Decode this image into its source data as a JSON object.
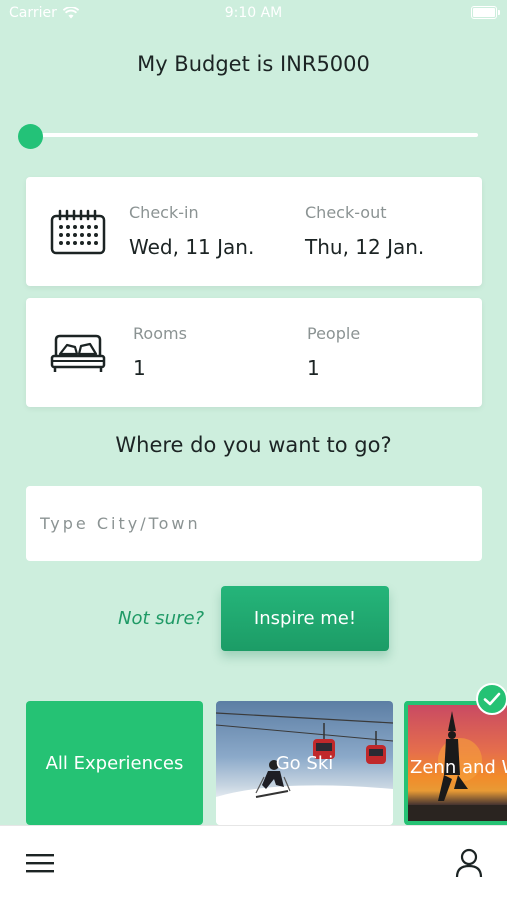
{
  "status_bar": {
    "carrier": "Carrier",
    "time": "9:10 AM"
  },
  "budget": {
    "title": "My Budget is INR5000",
    "slider_fraction": 0.0
  },
  "dates": {
    "checkin_label": "Check-in",
    "checkin_value": "Wed, 11 Jan.",
    "checkout_label": "Check-out",
    "checkout_value": "Thu, 12 Jan."
  },
  "occupancy": {
    "rooms_label": "Rooms",
    "rooms_value": "1",
    "people_label": "People",
    "people_value": "1"
  },
  "destination": {
    "question": "Where do you want to go?",
    "placeholder": "Type City/Town",
    "value": ""
  },
  "inspire": {
    "not_sure": "Not sure?",
    "button": "Inspire me!"
  },
  "experiences": [
    {
      "label": "All Experiences",
      "selected": false
    },
    {
      "label": "Go Ski",
      "selected": false
    },
    {
      "label": "Zenn and W",
      "selected": true
    }
  ],
  "icons": {
    "signal": "wifi-icon",
    "battery": "battery-icon",
    "calendar": "calendar-icon",
    "bed": "bed-icon",
    "check": "check-icon",
    "menu": "hamburger-menu-icon",
    "user": "user-icon"
  },
  "colors": {
    "background": "#cdeedd",
    "accent": "#25c274",
    "accent_dark": "#1f9a66",
    "card": "#ffffff"
  }
}
